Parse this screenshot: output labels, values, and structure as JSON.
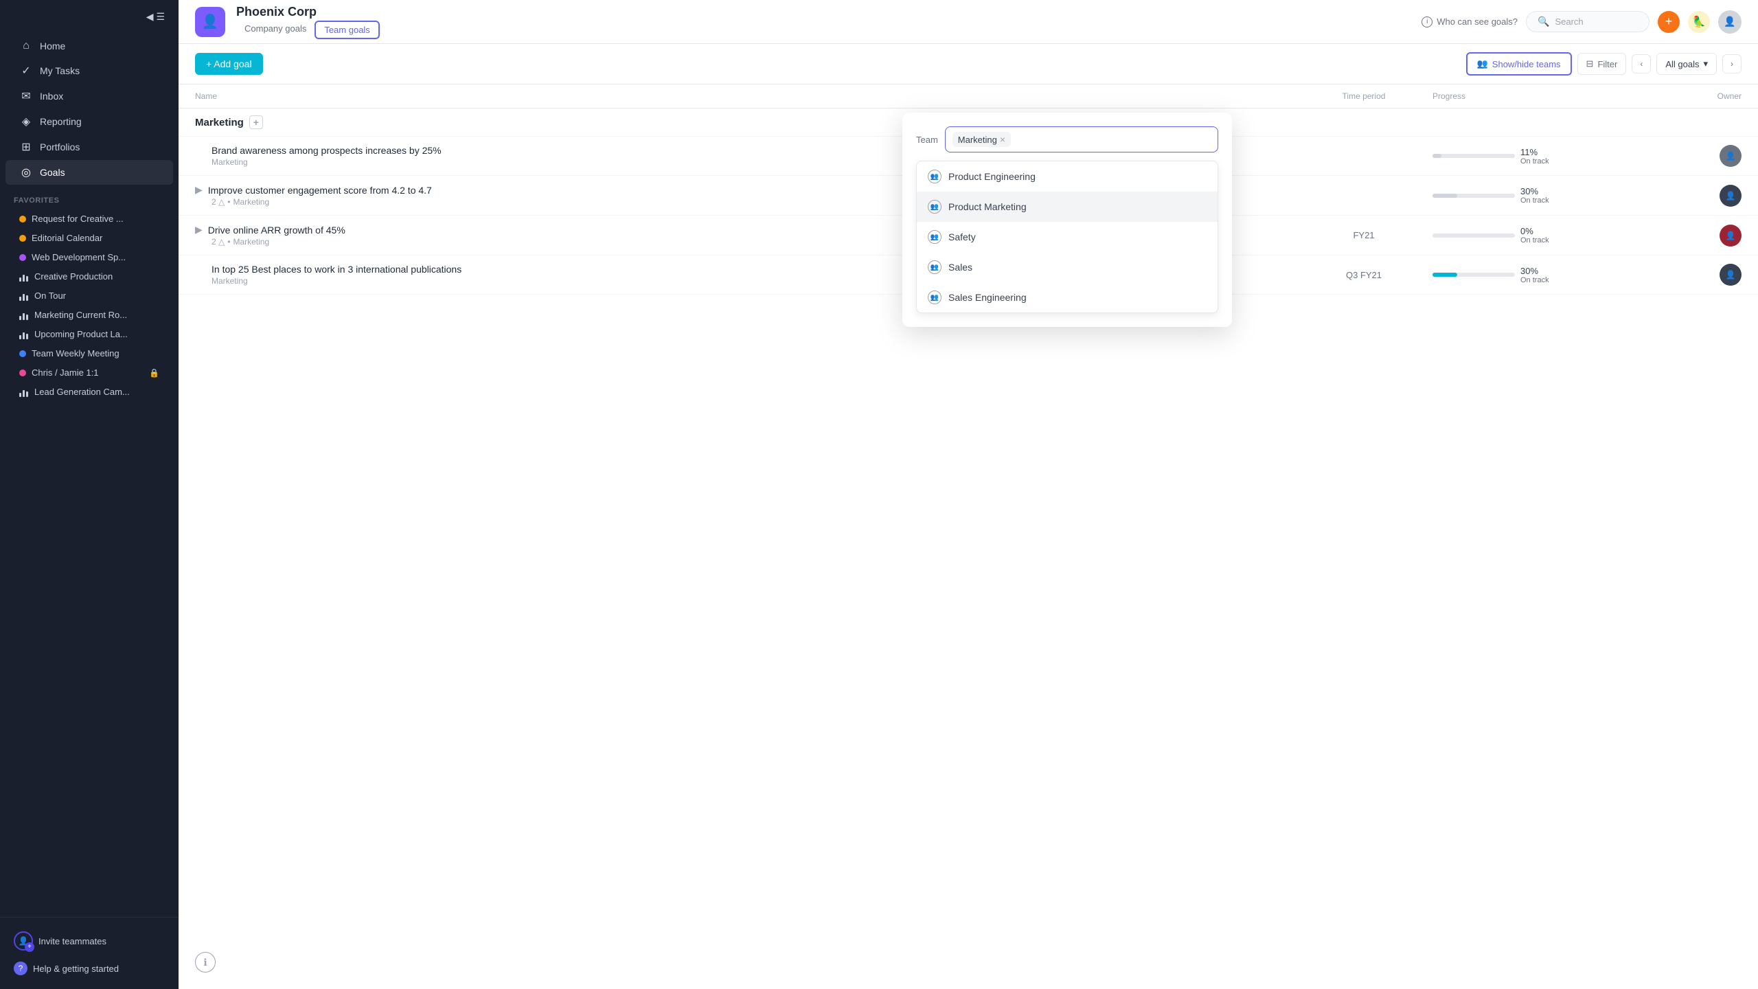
{
  "sidebar": {
    "toggle_icon": "☰",
    "nav_items": [
      {
        "id": "home",
        "label": "Home",
        "icon": "⌂"
      },
      {
        "id": "my-tasks",
        "label": "My Tasks",
        "icon": "✓"
      },
      {
        "id": "inbox",
        "label": "Inbox",
        "icon": "✉"
      },
      {
        "id": "reporting",
        "label": "Reporting",
        "icon": "◈"
      },
      {
        "id": "portfolios",
        "label": "Portfolios",
        "icon": "⊞"
      },
      {
        "id": "goals",
        "label": "Goals",
        "icon": "◎"
      }
    ],
    "favorites_label": "Favorites",
    "favorites": [
      {
        "id": "request-creative",
        "label": "Request for Creative ...",
        "type": "dot",
        "color": "#f59e0b"
      },
      {
        "id": "editorial-calendar",
        "label": "Editorial Calendar",
        "type": "dot",
        "color": "#f59e0b"
      },
      {
        "id": "web-development",
        "label": "Web Development Sp...",
        "type": "dot",
        "color": "#a855f7"
      },
      {
        "id": "creative-production",
        "label": "Creative Production",
        "type": "bar",
        "color": "#c8cdd8"
      },
      {
        "id": "on-tour",
        "label": "On Tour",
        "type": "bar",
        "color": "#c8cdd8"
      },
      {
        "id": "marketing-current",
        "label": "Marketing Current Ro...",
        "type": "bar",
        "color": "#c8cdd8"
      },
      {
        "id": "upcoming-product",
        "label": "Upcoming Product La...",
        "type": "bar",
        "color": "#c8cdd8"
      },
      {
        "id": "team-weekly",
        "label": "Team Weekly Meeting",
        "type": "dot",
        "color": "#3b82f6"
      },
      {
        "id": "chris-jamie",
        "label": "Chris / Jamie 1:1",
        "type": "dot",
        "color": "#ec4899"
      },
      {
        "id": "lead-generation",
        "label": "Lead Generation Cam...",
        "type": "bar",
        "color": "#c8cdd8"
      }
    ],
    "invite_label": "Invite teammates",
    "help_label": "Help & getting started"
  },
  "header": {
    "org_icon": "👤",
    "org_name": "Phoenix Corp",
    "tab_company": "Company goals",
    "tab_team": "Team goals",
    "who_can_see": "Who can see goals?",
    "search_placeholder": "Search",
    "add_icon": "+",
    "active_tab": "team"
  },
  "toolbar": {
    "add_goal_label": "+ Add goal",
    "show_hide_label": "Show/hide teams",
    "filter_label": "Filter",
    "all_goals_label": "All goals"
  },
  "table": {
    "columns": [
      "Name",
      "",
      "Time period",
      "Progress",
      "Owner"
    ],
    "section_label": "Marketing",
    "goals": [
      {
        "id": "goal-1",
        "name": "Brand awareness among prospects increases by 25%",
        "sub_tag": "Marketing",
        "period": "",
        "progress": 11,
        "progress_label": "On track",
        "bar_type": "normal",
        "has_chevron": false
      },
      {
        "id": "goal-2",
        "name": "Improve customer engagement score from 4.2 to 4.7",
        "sub_count": "2",
        "sub_tag": "Marketing",
        "period": "",
        "progress": 30,
        "progress_label": "On track",
        "bar_type": "normal",
        "has_chevron": true
      },
      {
        "id": "goal-3",
        "name": "Drive online ARR growth of 45%",
        "sub_count": "2",
        "sub_tag": "Marketing",
        "period": "FY21",
        "progress": 0,
        "progress_label": "On track",
        "bar_type": "normal",
        "has_chevron": true
      },
      {
        "id": "goal-4",
        "name": "In top 25 Best places to work in 3 international publications",
        "sub_tag": "Marketing",
        "period": "Q3 FY21",
        "progress": 30,
        "progress_label": "On track",
        "bar_type": "teal",
        "has_chevron": false
      }
    ]
  },
  "popup": {
    "label": "Team",
    "chip_label": "Marketing",
    "cursor_char": "|",
    "dropdown_items": [
      {
        "id": "product-engineering",
        "label": "Product Engineering"
      },
      {
        "id": "product-marketing",
        "label": "Product Marketing"
      },
      {
        "id": "safety",
        "label": "Safety"
      },
      {
        "id": "sales",
        "label": "Sales"
      },
      {
        "id": "sales-engineering",
        "label": "Sales Engineering"
      }
    ]
  },
  "info_circle": "ℹ"
}
